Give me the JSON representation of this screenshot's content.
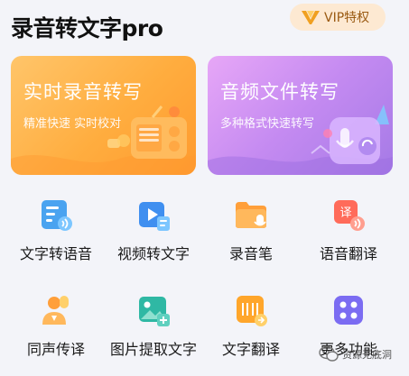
{
  "header": {
    "app_title": "录音转文字pro",
    "vip_label": "VIP特权"
  },
  "cards": [
    {
      "title": "实时录音转写",
      "subtitle": "精准快速 实时校对"
    },
    {
      "title": "音频文件转写",
      "subtitle": "多种格式快速转写"
    }
  ],
  "tools": [
    {
      "label": "文字转语音",
      "icon": "text-to-speech-icon"
    },
    {
      "label": "视频转文字",
      "icon": "video-to-text-icon"
    },
    {
      "label": "录音笔",
      "icon": "recorder-folder-icon"
    },
    {
      "label": "语音翻译",
      "icon": "voice-translate-icon"
    },
    {
      "label": "同声传译",
      "icon": "simultaneous-interpretation-icon"
    },
    {
      "label": "图片提取文字",
      "icon": "image-to-text-icon"
    },
    {
      "label": "文字翻译",
      "icon": "text-translate-icon"
    },
    {
      "label": "更多功能",
      "icon": "more-features-icon"
    }
  ],
  "watermark": {
    "label": "资源无底洞"
  },
  "colors": {
    "record_card": "#ffad3f",
    "file_card": "#c48af1",
    "vip_bg": "#fde9d2",
    "vip_text": "#9a5a12",
    "background": "#f3f4f9"
  }
}
